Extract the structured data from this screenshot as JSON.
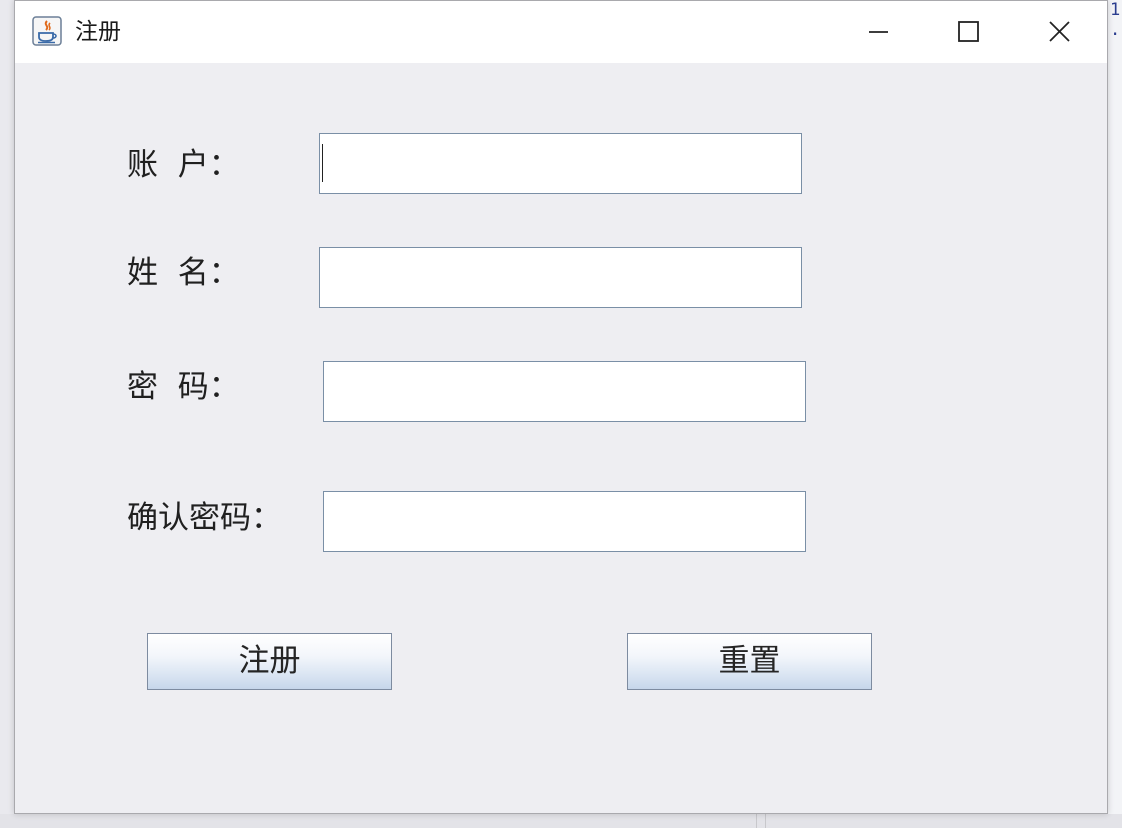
{
  "window": {
    "title": "注册",
    "controls": {
      "minimize": "minimize",
      "maximize": "maximize",
      "close": "close"
    }
  },
  "form": {
    "account": {
      "label": "账  户：",
      "value": ""
    },
    "name": {
      "label": "姓  名：",
      "value": ""
    },
    "password": {
      "label": "密  码：",
      "value": ""
    },
    "confirm_password": {
      "label": "确认密码：",
      "value": ""
    }
  },
  "buttons": {
    "register": "注册",
    "reset": "重置"
  },
  "background": {
    "code_glyphs": [
      "1",
      "."
    ]
  },
  "colors": {
    "window_bg": "#eeeef2",
    "titlebar_bg": "#ffffff",
    "field_border": "#7a8fa6",
    "button_gradient_bottom": "#c6d6ea",
    "bg_code_text": "#2b3d8f"
  },
  "icons": {
    "app": "java-coffee-icon",
    "minimize": "minimize-icon",
    "maximize": "maximize-icon",
    "close": "close-icon"
  }
}
